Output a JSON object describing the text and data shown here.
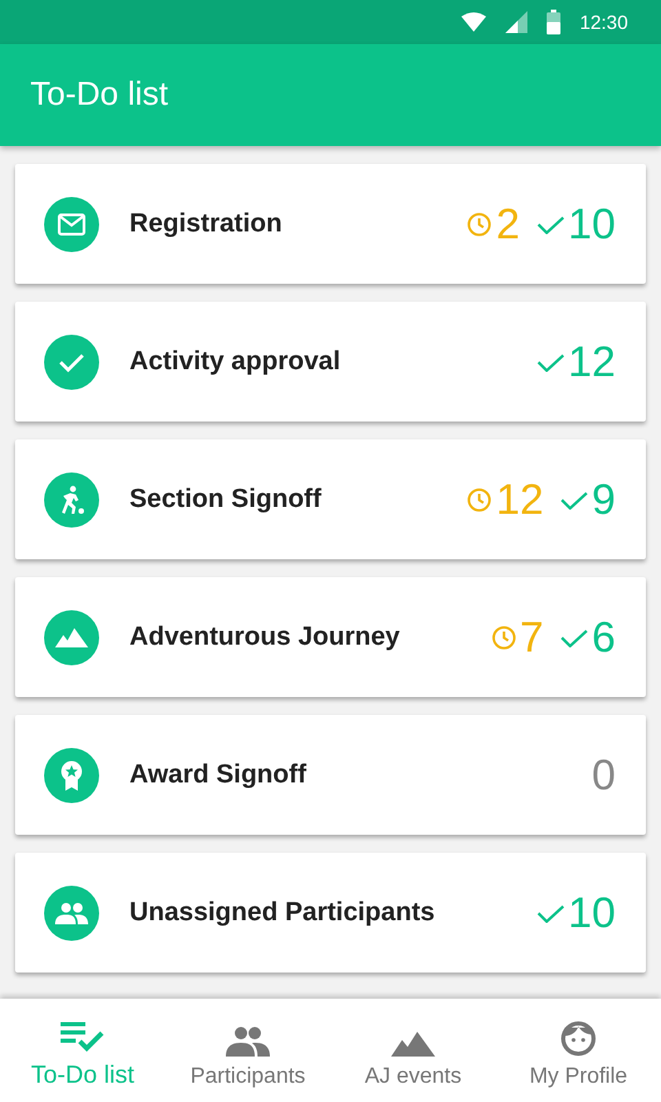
{
  "status_bar": {
    "time": "12:30"
  },
  "app_bar": {
    "title": "To-Do list"
  },
  "tasks": [
    {
      "label": "Registration",
      "counts": [
        {
          "kind": "pending",
          "value": "2"
        },
        {
          "kind": "done",
          "value": "10"
        }
      ]
    },
    {
      "label": "Activity approval",
      "counts": [
        {
          "kind": "done",
          "value": "12"
        }
      ]
    },
    {
      "label": "Section Signoff",
      "counts": [
        {
          "kind": "pending",
          "value": "12"
        },
        {
          "kind": "done",
          "value": "9"
        }
      ]
    },
    {
      "label": "Adventurous Journey",
      "counts": [
        {
          "kind": "pending",
          "value": "7"
        },
        {
          "kind": "done",
          "value": "6"
        }
      ]
    },
    {
      "label": "Award Signoff",
      "counts": [
        {
          "kind": "none",
          "value": "0"
        }
      ]
    },
    {
      "label": "Unassigned Participants",
      "counts": [
        {
          "kind": "done",
          "value": "10"
        }
      ]
    }
  ],
  "bottom_nav": [
    {
      "label": "To-Do list",
      "selected": true
    },
    {
      "label": "Participants",
      "selected": false
    },
    {
      "label": "AJ events",
      "selected": false
    },
    {
      "label": "My Profile",
      "selected": false
    }
  ]
}
